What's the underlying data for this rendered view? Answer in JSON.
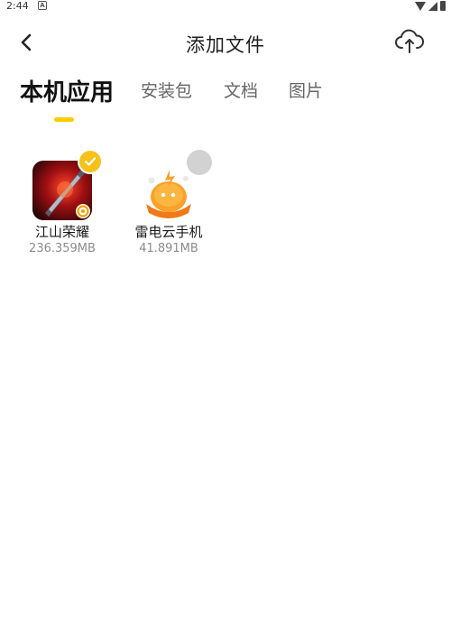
{
  "status_bar": {
    "time": "2:44",
    "notification_glyph": "A"
  },
  "header": {
    "title": "添加文件"
  },
  "tabs": [
    {
      "label": "本机应用",
      "active": true
    },
    {
      "label": "安装包",
      "active": false
    },
    {
      "label": "文档",
      "active": false
    },
    {
      "label": "图片",
      "active": false
    }
  ],
  "apps": [
    {
      "name": "江山荣耀",
      "size": "236.359MB",
      "selected": true
    },
    {
      "name": "雷电云手机",
      "size": "41.891MB",
      "selected": false
    }
  ],
  "colors": {
    "accent": "#f5c11a",
    "indicator": "#ffcc00",
    "unselected_badge": "#d2d2d2"
  }
}
